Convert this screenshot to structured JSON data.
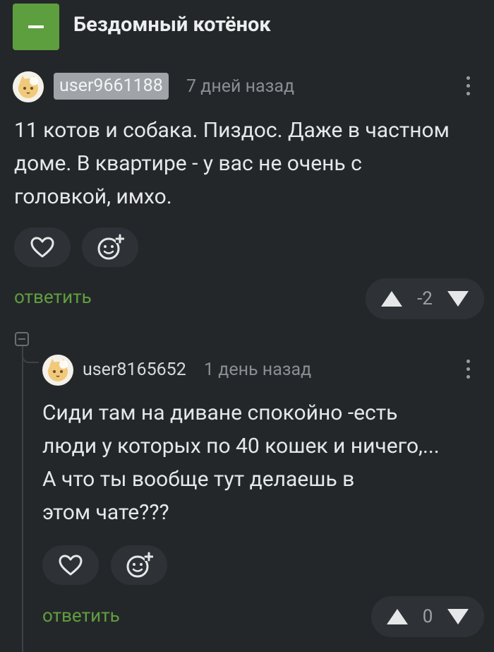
{
  "post": {
    "title": "Бездомный котёнок"
  },
  "comments": [
    {
      "username": "user9661188",
      "time": "7 дней назад",
      "lines": [
        "11 котов и собака. Пиздос. Даже в частном",
        "доме. В квартире - у вас не очень с",
        "головкой, имхо."
      ],
      "reply_label": "ответить",
      "rating": "-2"
    },
    {
      "username": "user8165652",
      "time": "1 день назад",
      "lines": [
        "Сиди там на диване спокойно -есть",
        "люди у которых по 40 кошек и ничего,...",
        "А что ты вообще тут делаешь в",
        "этом чате???"
      ],
      "reply_label": "ответить",
      "rating": "0"
    }
  ],
  "colors": {
    "accent": "#5d9f3f",
    "background": "#24272a",
    "badge": "#a0a3a7"
  },
  "icons": [
    "minus-icon",
    "heart-icon",
    "emoji-add-icon",
    "upvote-icon",
    "downvote-icon",
    "kebab-menu-icon"
  ]
}
